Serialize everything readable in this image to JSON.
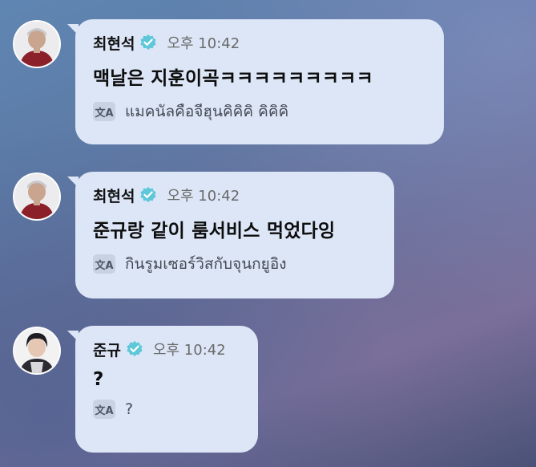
{
  "messages": [
    {
      "author": "최현석",
      "time": "오후 10:42",
      "text": "맥날은 지훈이곡ㅋㅋㅋㅋㅋㅋㅋㅋㅋ",
      "translation": "แมคนัลคือจีฮุนคิคิคิ คิคิคิ",
      "avatar": "hyunsuk-avatar"
    },
    {
      "author": "최현석",
      "time": "오후 10:42",
      "text": "준규랑 같이 룸서비스 먹었다잉",
      "translation": "กินรูมเซอร์วิสกับจุนกยูอิง",
      "avatar": "hyunsuk-avatar"
    },
    {
      "author": "준규",
      "time": "오후 10:42",
      "text": "?",
      "translation": "?",
      "avatar": "junkyu-avatar"
    }
  ],
  "icons": {
    "verified": "verified-badge-icon",
    "translate": "translate-icon"
  },
  "colors": {
    "bubble": "#dde6f7",
    "verified": "#5ec8d8"
  }
}
